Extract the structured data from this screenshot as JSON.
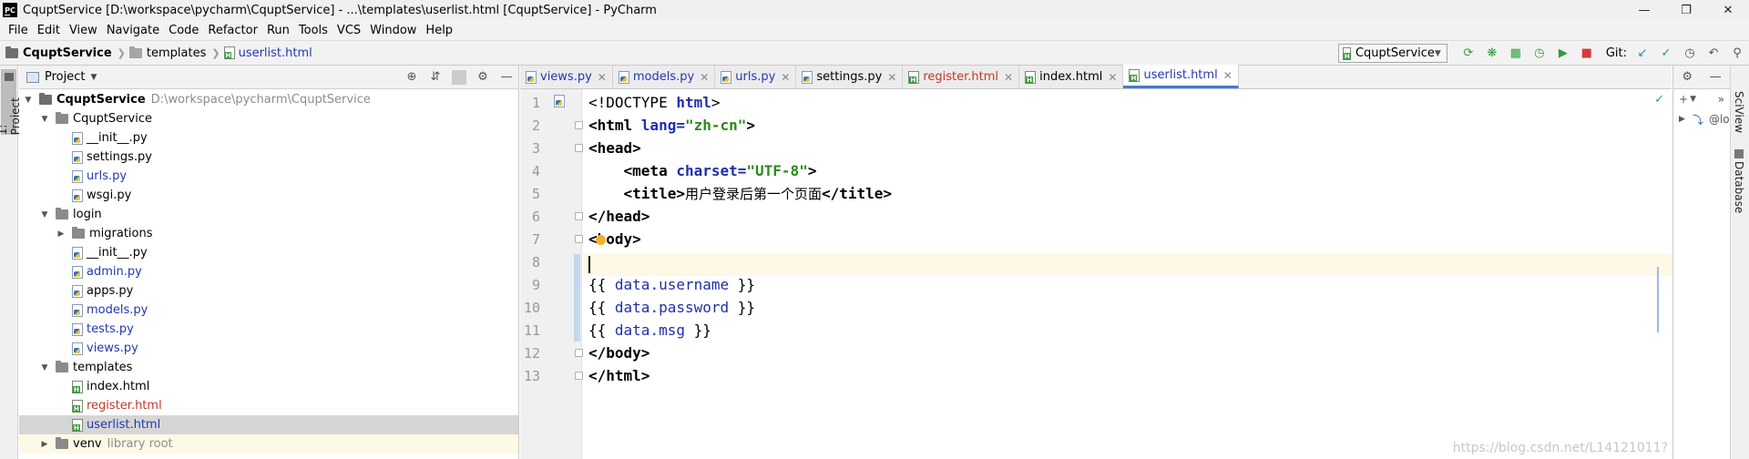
{
  "window": {
    "title": "CquptService [D:\\workspace\\pycharm\\CquptService] - ...\\templates\\userlist.html [CquptService] - PyCharm",
    "app_logo": "PC"
  },
  "menu": [
    {
      "label": "File"
    },
    {
      "label": "Edit"
    },
    {
      "label": "View"
    },
    {
      "label": "Navigate"
    },
    {
      "label": "Code"
    },
    {
      "label": "Refactor"
    },
    {
      "label": "Run"
    },
    {
      "label": "Tools"
    },
    {
      "label": "VCS"
    },
    {
      "label": "Window"
    },
    {
      "label": "Help"
    }
  ],
  "breadcrumb": {
    "project": "CquptService",
    "folder": "templates",
    "file": "userlist.html"
  },
  "toolbar": {
    "run_config": "CquptService",
    "git_label": "Git:"
  },
  "left_strip": {
    "project_tab": "1: Project"
  },
  "project_panel": {
    "title": "Project",
    "tree": [
      {
        "label": "CquptService",
        "extra": "D:\\workspace\\pycharm\\CquptService",
        "type": "root",
        "expanded": true
      },
      {
        "label": "CquptService",
        "type": "folder",
        "expanded": true
      },
      {
        "label": "__init__.py",
        "type": "py"
      },
      {
        "label": "settings.py",
        "type": "py"
      },
      {
        "label": "urls.py",
        "type": "py",
        "modified": true
      },
      {
        "label": "wsgi.py",
        "type": "py"
      },
      {
        "label": "login",
        "type": "folder",
        "expanded": true
      },
      {
        "label": "migrations",
        "type": "folder",
        "expanded": false
      },
      {
        "label": "__init__.py",
        "type": "py"
      },
      {
        "label": "admin.py",
        "type": "py",
        "modified": true
      },
      {
        "label": "apps.py",
        "type": "py"
      },
      {
        "label": "models.py",
        "type": "py",
        "modified": true
      },
      {
        "label": "tests.py",
        "type": "py",
        "modified": true
      },
      {
        "label": "views.py",
        "type": "py",
        "modified": true
      },
      {
        "label": "templates",
        "type": "folder",
        "expanded": true
      },
      {
        "label": "index.html",
        "type": "html"
      },
      {
        "label": "register.html",
        "type": "html",
        "status": "red"
      },
      {
        "label": "userlist.html",
        "type": "html",
        "modified": true,
        "selected": true
      },
      {
        "label": "venv",
        "extra": "library root",
        "type": "folder",
        "expanded": false
      }
    ]
  },
  "editor_tabs": [
    {
      "label": "views.py",
      "color": "blue"
    },
    {
      "label": "models.py",
      "color": "blue"
    },
    {
      "label": "urls.py",
      "color": "blue"
    },
    {
      "label": "settings.py",
      "color": "black"
    },
    {
      "label": "register.html",
      "color": "red"
    },
    {
      "label": "index.html",
      "color": "black"
    },
    {
      "label": "userlist.html",
      "color": "blue",
      "active": true
    }
  ],
  "editor": {
    "line_numbers": [
      "1",
      "2",
      "3",
      "4",
      "5",
      "6",
      "7",
      "8",
      "9",
      "10",
      "11",
      "12",
      "13"
    ],
    "lines": {
      "l1_a": "<!DOCTYPE ",
      "l1_b": "html",
      "l1_c": ">",
      "l2_a": "<html ",
      "l2_b": "lang=",
      "l2_c": "\"zh-cn\"",
      "l2_d": ">",
      "l3": "<head>",
      "l4_a": "    <meta ",
      "l4_b": "charset=",
      "l4_c": "\"UTF-8\"",
      "l4_d": ">",
      "l5_a": "    <title>",
      "l5_b": "用户登录后第一个页面",
      "l5_c": "</title>",
      "l6": "</head>",
      "l7_a": "<",
      "l7_b": "body>",
      "l9_a": "{{ ",
      "l9_b": "data.username",
      "l9_c": " }}",
      "l10_a": "{{ ",
      "l10_b": "data.password",
      "l10_c": " }}",
      "l11_a": "{{ ",
      "l11_b": "data.msg",
      "l11_c": " }}",
      "l12": "</body>",
      "l13": "</html>"
    }
  },
  "right_panel": {
    "row_label": "@lo",
    "tabs": [
      "SciView",
      "Database"
    ]
  },
  "watermark": "https://blog.csdn.net/L14121011?"
}
